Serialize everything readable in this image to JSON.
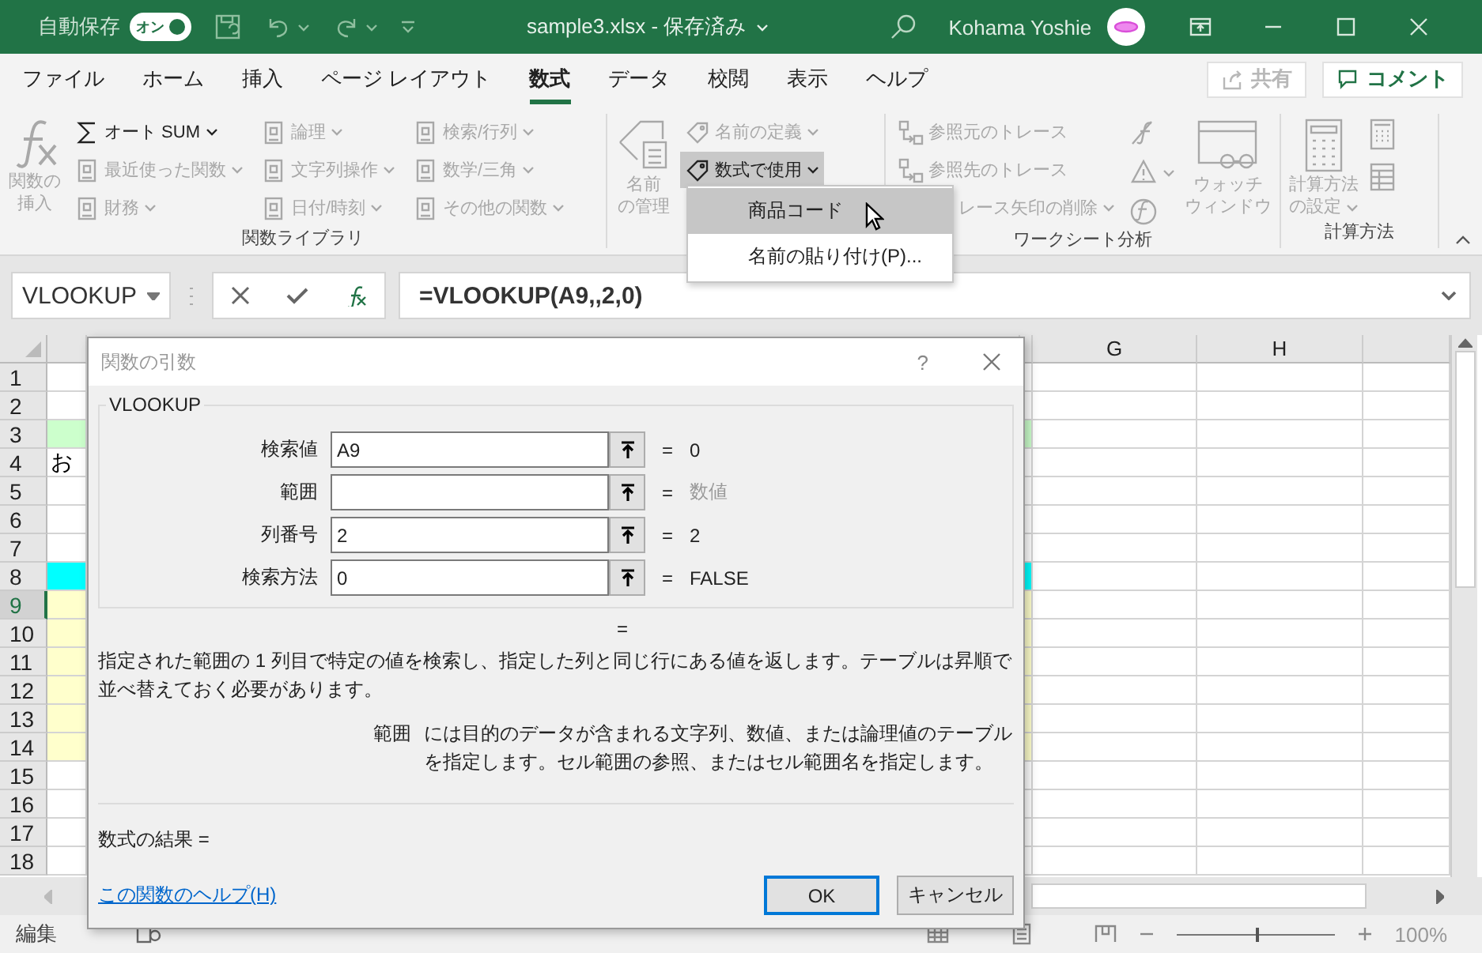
{
  "title_bar": {
    "autosave_label": "自動保存",
    "autosave_toggle": {
      "label": "オン",
      "on": true
    },
    "title": "sample3.xlsx - 保存済み",
    "user": "Kohama Yoshie"
  },
  "tabs": [
    {
      "label": "ファイル",
      "selected": false
    },
    {
      "label": "ホーム",
      "selected": false
    },
    {
      "label": "挿入",
      "selected": false
    },
    {
      "label": "ページ レイアウト",
      "selected": false
    },
    {
      "label": "数式",
      "selected": true
    },
    {
      "label": "データ",
      "selected": false
    },
    {
      "label": "校閲",
      "selected": false
    },
    {
      "label": "表示",
      "selected": false
    },
    {
      "label": "ヘルプ",
      "selected": false
    }
  ],
  "share": {
    "label": "共有",
    "disabled": true
  },
  "comment": {
    "label": "コメント"
  },
  "ribbon": [
    {
      "label": "関数ライブラリ",
      "items": [
        {
          "kind": "large",
          "lines": [
            "関数の",
            "挿入"
          ],
          "disabled": true
        },
        {
          "kind": "column",
          "items": [
            {
              "label": "オート SUM",
              "caret": true,
              "disabled": false
            },
            {
              "label": "最近使った関数",
              "caret": true,
              "disabled": true
            },
            {
              "label": "財務",
              "caret": true,
              "disabled": true
            }
          ]
        },
        {
          "kind": "column",
          "items": [
            {
              "label": "論理",
              "caret": true,
              "disabled": true
            },
            {
              "label": "文字列操作",
              "caret": true,
              "disabled": true
            },
            {
              "label": "日付/時刻",
              "caret": true,
              "disabled": true
            }
          ]
        },
        {
          "kind": "column",
          "items": [
            {
              "label": "検索/行列",
              "caret": true,
              "disabled": true
            },
            {
              "label": "数学/三角",
              "caret": true,
              "disabled": true
            },
            {
              "label": "その他の関数",
              "caret": true,
              "disabled": true
            }
          ]
        }
      ]
    },
    {
      "items": [
        {
          "kind": "large",
          "lines": [
            "名前",
            "の管理"
          ],
          "disabled": true
        },
        {
          "kind": "column",
          "items": [
            {
              "label": "名前の定義",
              "caret": true,
              "disabled": true
            },
            {
              "label": "数式で使用",
              "caret": true,
              "disabled": false,
              "expanded": true
            }
          ]
        }
      ]
    },
    {
      "label": "ワークシート分析",
      "items": [
        {
          "kind": "column",
          "items": [
            {
              "label": "参照元のトレース",
              "caret": false,
              "disabled": true
            },
            {
              "label": "参照先のトレース",
              "caret": false,
              "disabled": true
            },
            {
              "label": "レース矢印の削除",
              "caret": true,
              "disabled": true,
              "cut": true
            }
          ]
        },
        {
          "kind": "icons",
          "items": [
            {
              "caret": false
            },
            {
              "caret": true
            },
            {
              "caret": false
            }
          ]
        },
        {
          "kind": "large",
          "lines": [
            "ウォッチ",
            "ウィンドウ"
          ],
          "disabled": true
        }
      ]
    },
    {
      "label": "計算方法",
      "items": [
        {
          "kind": "large",
          "lines": [
            "計算方法",
            "の設定"
          ],
          "disabled": true,
          "caret": true
        },
        {
          "kind": "icons",
          "items": [
            {
              "caret": false
            },
            {
              "caret": false
            }
          ]
        }
      ]
    }
  ],
  "menu": [
    {
      "label": "商品コード",
      "selected": true
    },
    {
      "label": "名前の貼り付け(P)...",
      "selected": false
    }
  ],
  "formula_bar": {
    "name_box": "VLOOKUP",
    "formula": "=VLOOKUP(A9,,2,0)"
  },
  "sheet": {
    "columns": [
      "G",
      "H"
    ],
    "rows": [
      {
        "number": "1",
        "selected": false
      },
      {
        "number": "2",
        "selected": false
      },
      {
        "number": "3",
        "selected": false,
        "color": "#ccffcc"
      },
      {
        "number": "4",
        "selected": false,
        "text": "お"
      },
      {
        "number": "5",
        "selected": false
      },
      {
        "number": "6",
        "selected": false
      },
      {
        "number": "7",
        "selected": false
      },
      {
        "number": "8",
        "selected": false,
        "color": "#00ffff"
      },
      {
        "number": "9",
        "selected": true,
        "color": "#ffffcc"
      },
      {
        "number": "10",
        "selected": false,
        "color": "#ffffcc"
      },
      {
        "number": "11",
        "selected": false,
        "color": "#ffffcc"
      },
      {
        "number": "12",
        "selected": false,
        "color": "#ffffcc"
      },
      {
        "number": "13",
        "selected": false,
        "color": "#ffffcc"
      },
      {
        "number": "14",
        "selected": false,
        "color": "#ffffcc"
      },
      {
        "number": "15",
        "selected": false
      },
      {
        "number": "16",
        "selected": false
      },
      {
        "number": "17",
        "selected": false
      },
      {
        "number": "18",
        "selected": false
      }
    ]
  },
  "dialog": {
    "title": "関数の引数",
    "help": "?",
    "function": "VLOOKUP",
    "args": [
      {
        "label": "検索値",
        "value": "A9",
        "equals": "=",
        "result": "0",
        "hint": false
      },
      {
        "label": "範囲",
        "equals": "=",
        "result": "数値",
        "hint": true
      },
      {
        "label": "列番号",
        "value": "2",
        "equals": "=",
        "result": "2",
        "hint": false
      },
      {
        "label": "検索方法",
        "value": "0",
        "equals": "=",
        "result": "FALSE",
        "hint": false
      }
    ],
    "total_equals": "=",
    "description": "指定された範囲の 1 列目で特定の値を検索し、指定した列と同じ行にある値を返します。テーブルは昇順で並べ替えておく必要があります。",
    "arg_help": {
      "name": "範囲",
      "text": "には目的のデータが含まれる文字列、数値、または論理値のテーブルを指定します。セル範囲の参照、またはセル範囲名を指定します。"
    },
    "result_label": "数式の結果 =",
    "help_link": "この関数のヘルプ(H)",
    "buttons": [
      {
        "label": "OK",
        "default": true
      },
      {
        "label": "キャンセル",
        "default": false
      }
    ]
  },
  "status_bar": {
    "mode": "編集",
    "zoom": {
      "level": 0.5,
      "reading": "100%"
    }
  }
}
